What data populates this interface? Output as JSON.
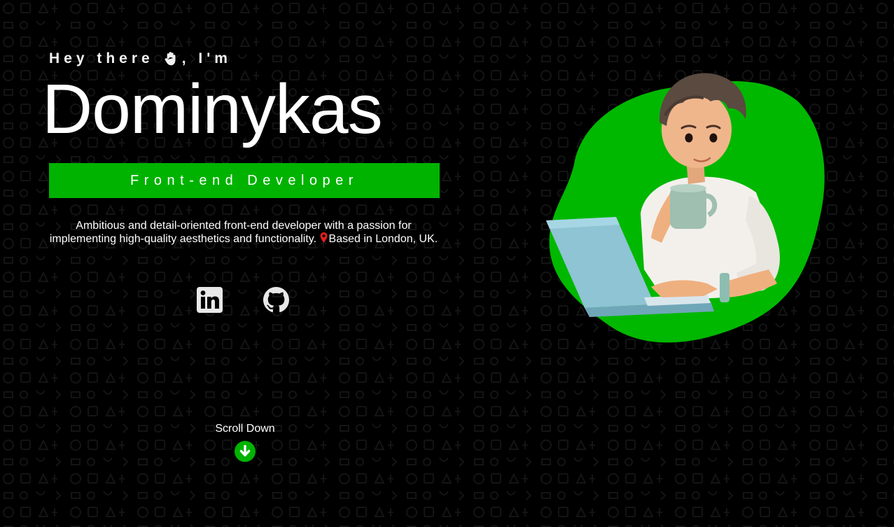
{
  "hero": {
    "greeting_prefix": "Hey there",
    "greeting_suffix": ", I'm",
    "name": "Dominykas",
    "role": "Front-end Developer",
    "bio_text": "Ambitious and detail-oriented front-end developer with a passion for implementing high-quality aesthetics and functionality.",
    "location_text": "Based in London, UK."
  },
  "socials": [
    {
      "label": "LinkedIn",
      "icon": "linkedin-icon"
    },
    {
      "label": "GitHub",
      "icon": "github-icon"
    }
  ],
  "scroll": {
    "label": "Scroll Down",
    "icon": "arrow-down-circle-icon"
  },
  "theme": {
    "background": "#000000",
    "accent": "#00b300",
    "pin_color": "#e02020",
    "text": "#ffffff"
  }
}
